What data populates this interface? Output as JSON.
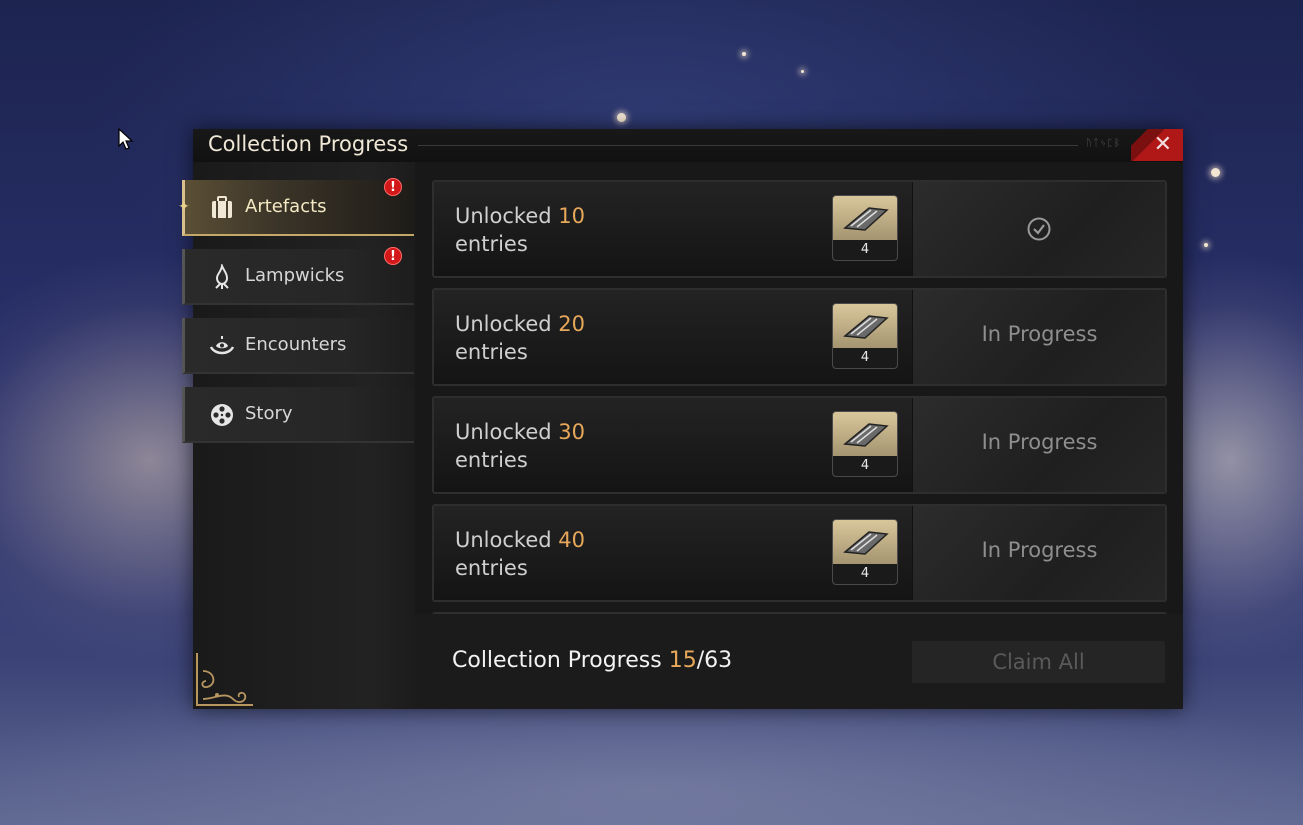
{
  "window": {
    "title": "Collection Progress",
    "close_label": "✕",
    "title_runes": "ᚢᛏᛃᛈᛒ"
  },
  "sidebar": {
    "tabs": [
      {
        "label": "Artefacts",
        "icon": "suitcase-icon",
        "active": true,
        "alert": "!"
      },
      {
        "label": "Lampwicks",
        "icon": "flame-icon",
        "active": false,
        "alert": "!"
      },
      {
        "label": "Encounters",
        "icon": "hand-eye-icon",
        "active": false,
        "alert": ""
      },
      {
        "label": "Story",
        "icon": "film-reel-icon",
        "active": false,
        "alert": ""
      }
    ]
  },
  "milestones": [
    {
      "prefix": "Unlocked",
      "count": "10",
      "suffix": "entries",
      "reward_qty": "4",
      "status": "claimed",
      "status_label": ""
    },
    {
      "prefix": "Unlocked",
      "count": "20",
      "suffix": "entries",
      "reward_qty": "4",
      "status": "in_progress",
      "status_label": "In Progress"
    },
    {
      "prefix": "Unlocked",
      "count": "30",
      "suffix": "entries",
      "reward_qty": "4",
      "status": "in_progress",
      "status_label": "In Progress"
    },
    {
      "prefix": "Unlocked",
      "count": "40",
      "suffix": "entries",
      "reward_qty": "4",
      "status": "in_progress",
      "status_label": "In Progress"
    }
  ],
  "footer": {
    "label": "Collection Progress",
    "current": "15",
    "separator": "/",
    "total": "63",
    "claim_all_label": "Claim All"
  },
  "colors": {
    "accent_gold": "#e7a85a",
    "close_red": "#b01818",
    "alert_red": "#d21818"
  }
}
